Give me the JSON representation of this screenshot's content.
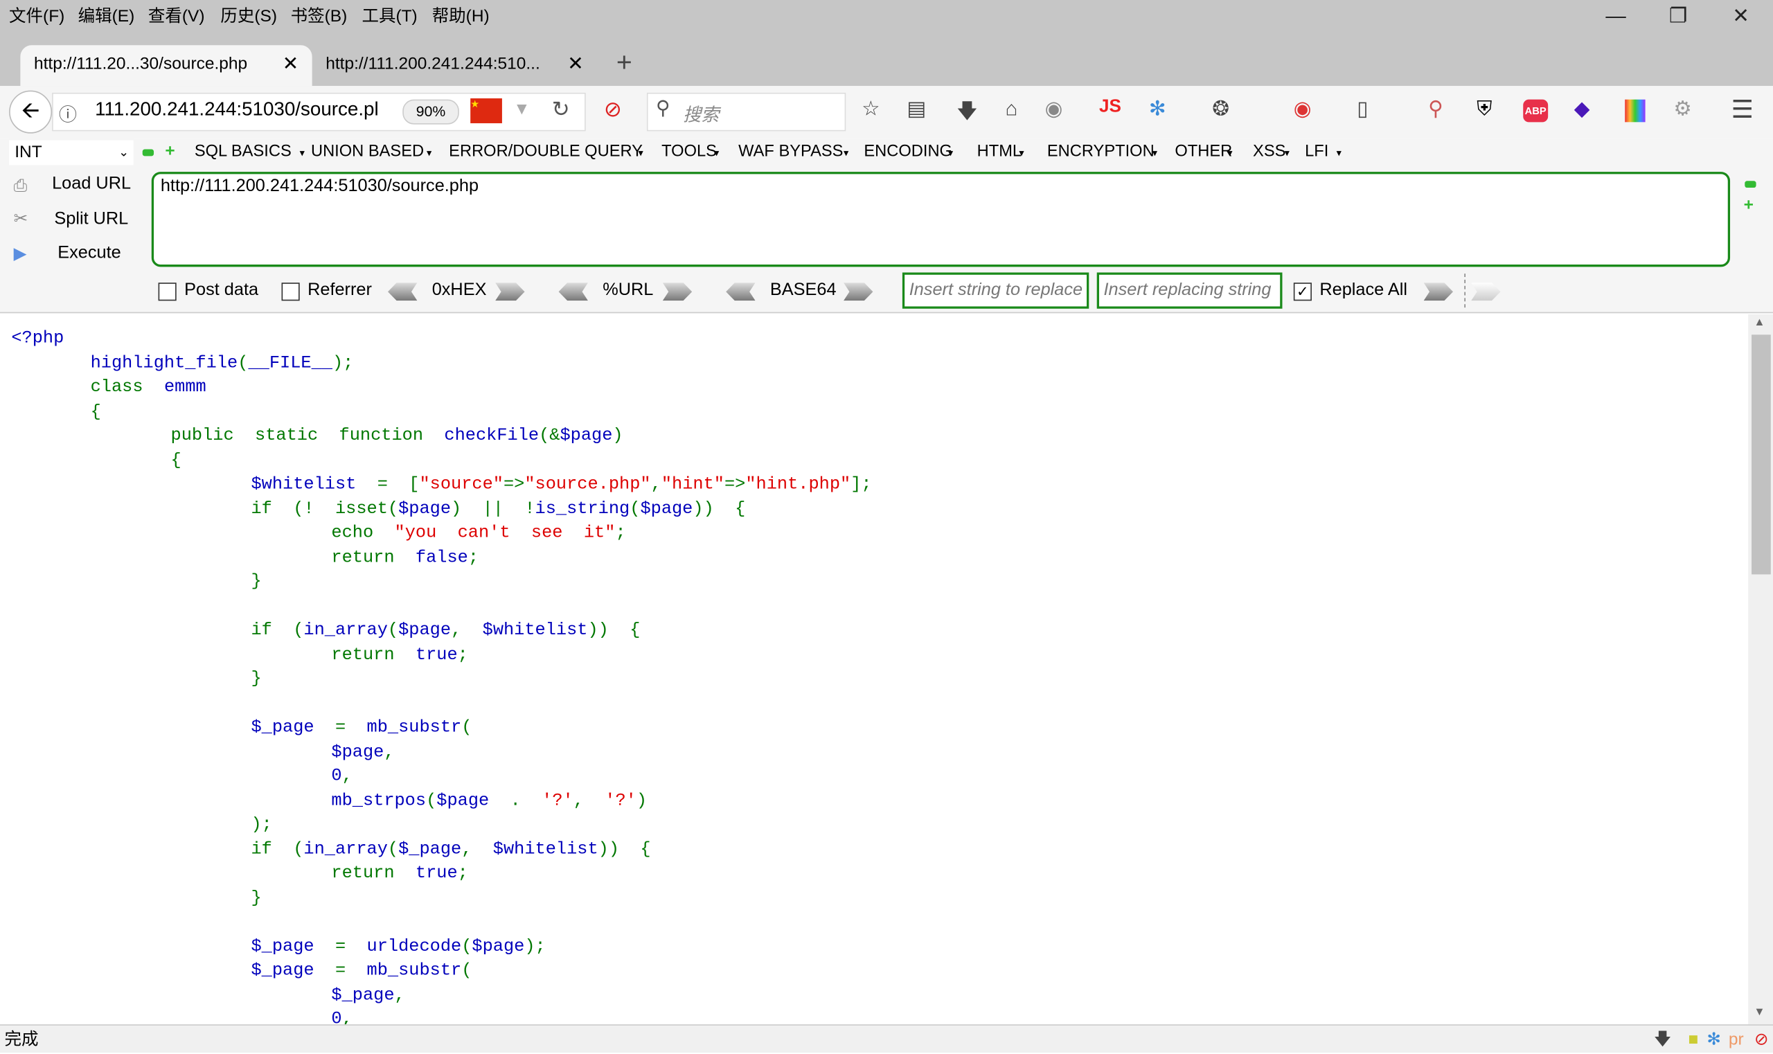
{
  "menu": [
    "文件(F)",
    "编辑(E)",
    "查看(V)",
    "历史(S)",
    "书签(B)",
    "工具(T)",
    "帮助(H)"
  ],
  "tabs": [
    {
      "label": "http://111.20...30/source.php"
    },
    {
      "label": "http://111.200.241.244:510..."
    }
  ],
  "new_tab": "+",
  "address": {
    "url": "111.200.241.244:51030/source.pl",
    "zoom": "90%",
    "search_placeholder": "搜索"
  },
  "toolbar_icons": [
    "star-icon",
    "reading-list-icon",
    "download-icon",
    "home-icon",
    "globe-icon",
    "js-icon",
    "proxy-icon",
    "cookie-icon",
    "web-developer-icon",
    "responsive-icon",
    "search-highlight-icon",
    "shield-w-icon",
    "abp-icon",
    "diamond-icon",
    "rainbow-icon",
    "gear-icon"
  ],
  "js_label": "JS",
  "abp_label": "ABP",
  "hackbar": {
    "select": "INT",
    "menus": [
      "SQL BASICS",
      "UNION BASED",
      "ERROR/DOUBLE QUERY",
      "TOOLS",
      "WAF BYPASS",
      "ENCODING",
      "HTML",
      "ENCRYPTION",
      "OTHER",
      "XSS",
      "LFI"
    ],
    "load": "Load URL",
    "split": "Split URL",
    "execute": "Execute",
    "url": "http://111.200.241.244:51030/source.php",
    "post": "Post data",
    "referrer": "Referrer",
    "hex": "0xHEX",
    "urlenc": "%URL",
    "base64": "BASE64",
    "replace_placeholder": "Insert string to replace",
    "replacing_placeholder": "Insert replacing string",
    "replace_all": "Replace All",
    "replace_all_checked": true,
    "post_checked": false,
    "referrer_checked": false
  },
  "colors": {
    "keyword": "#007700",
    "default": "#0000bb",
    "string": "#dd0000",
    "border": "#1a8a1a"
  },
  "code": [
    {
      "i": 0,
      "t": [
        [
          "<?php",
          "d"
        ]
      ]
    },
    {
      "i": 1,
      "t": [
        [
          "highlight_file",
          "d"
        ],
        [
          "(",
          "k"
        ],
        [
          "__FILE__",
          "d"
        ],
        [
          ");",
          "k"
        ]
      ]
    },
    {
      "i": 1,
      "t": [
        [
          "class  ",
          "k"
        ],
        [
          "emmm",
          "d"
        ]
      ]
    },
    {
      "i": 1,
      "t": [
        [
          "{",
          "k"
        ]
      ]
    },
    {
      "i": 2,
      "t": [
        [
          "public  static  function  ",
          "k"
        ],
        [
          "checkFile",
          "d"
        ],
        [
          "(&",
          "k"
        ],
        [
          "$page",
          "d"
        ],
        [
          ")",
          "k"
        ]
      ]
    },
    {
      "i": 2,
      "t": [
        [
          "{",
          "k"
        ]
      ]
    },
    {
      "i": 3,
      "t": [
        [
          "$whitelist  ",
          "d"
        ],
        [
          "=  [",
          "k"
        ],
        [
          "\"source\"",
          "s"
        ],
        [
          "=>",
          "k"
        ],
        [
          "\"source.php\"",
          "s"
        ],
        [
          ",",
          "k"
        ],
        [
          "\"hint\"",
          "s"
        ],
        [
          "=>",
          "k"
        ],
        [
          "\"hint.php\"",
          "s"
        ],
        [
          "];",
          "k"
        ]
      ]
    },
    {
      "i": 3,
      "t": [
        [
          "if  (!  isset(",
          "k"
        ],
        [
          "$page",
          "d"
        ],
        [
          ")  ||  !",
          "k"
        ],
        [
          "is_string",
          "d"
        ],
        [
          "(",
          "k"
        ],
        [
          "$page",
          "d"
        ],
        [
          "))  {",
          "k"
        ]
      ]
    },
    {
      "i": 4,
      "t": [
        [
          "echo  ",
          "k"
        ],
        [
          "\"you  can't  see  it\"",
          "s"
        ],
        [
          ";",
          "k"
        ]
      ]
    },
    {
      "i": 4,
      "t": [
        [
          "return  ",
          "k"
        ],
        [
          "false",
          "d"
        ],
        [
          ";",
          "k"
        ]
      ]
    },
    {
      "i": 3,
      "t": [
        [
          "}",
          "k"
        ]
      ]
    },
    {
      "i": 3,
      "t": []
    },
    {
      "i": 3,
      "t": [
        [
          "if  (",
          "k"
        ],
        [
          "in_array",
          "d"
        ],
        [
          "(",
          "k"
        ],
        [
          "$page",
          "d"
        ],
        [
          ",  ",
          "k"
        ],
        [
          "$whitelist",
          "d"
        ],
        [
          "))  {",
          "k"
        ]
      ]
    },
    {
      "i": 4,
      "t": [
        [
          "return  ",
          "k"
        ],
        [
          "true",
          "d"
        ],
        [
          ";",
          "k"
        ]
      ]
    },
    {
      "i": 3,
      "t": [
        [
          "}",
          "k"
        ]
      ]
    },
    {
      "i": 3,
      "t": []
    },
    {
      "i": 3,
      "t": [
        [
          "$_page  ",
          "d"
        ],
        [
          "=  ",
          "k"
        ],
        [
          "mb_substr",
          "d"
        ],
        [
          "(",
          "k"
        ]
      ]
    },
    {
      "i": 4,
      "t": [
        [
          "$page",
          "d"
        ],
        [
          ",",
          "k"
        ]
      ]
    },
    {
      "i": 4,
      "t": [
        [
          "0",
          "d"
        ],
        [
          ",",
          "k"
        ]
      ]
    },
    {
      "i": 4,
      "t": [
        [
          "mb_strpos",
          "d"
        ],
        [
          "(",
          "k"
        ],
        [
          "$page  ",
          "d"
        ],
        [
          ".  ",
          "k"
        ],
        [
          "'?'",
          "s"
        ],
        [
          ",  ",
          "k"
        ],
        [
          "'?'",
          "s"
        ],
        [
          ")",
          "k"
        ]
      ]
    },
    {
      "i": 3,
      "t": [
        [
          ");",
          "k"
        ]
      ]
    },
    {
      "i": 3,
      "t": [
        [
          "if  (",
          "k"
        ],
        [
          "in_array",
          "d"
        ],
        [
          "(",
          "k"
        ],
        [
          "$_page",
          "d"
        ],
        [
          ",  ",
          "k"
        ],
        [
          "$whitelist",
          "d"
        ],
        [
          "))  {",
          "k"
        ]
      ]
    },
    {
      "i": 4,
      "t": [
        [
          "return  ",
          "k"
        ],
        [
          "true",
          "d"
        ],
        [
          ";",
          "k"
        ]
      ]
    },
    {
      "i": 3,
      "t": [
        [
          "}",
          "k"
        ]
      ]
    },
    {
      "i": 3,
      "t": []
    },
    {
      "i": 3,
      "t": [
        [
          "$_page  ",
          "d"
        ],
        [
          "=  ",
          "k"
        ],
        [
          "urldecode",
          "d"
        ],
        [
          "(",
          "k"
        ],
        [
          "$page",
          "d"
        ],
        [
          ");",
          "k"
        ]
      ]
    },
    {
      "i": 3,
      "t": [
        [
          "$_page  ",
          "d"
        ],
        [
          "=  ",
          "k"
        ],
        [
          "mb_substr",
          "d"
        ],
        [
          "(",
          "k"
        ]
      ]
    },
    {
      "i": 4,
      "t": [
        [
          "$_page",
          "d"
        ],
        [
          ",",
          "k"
        ]
      ]
    },
    {
      "i": 4,
      "t": [
        [
          "0",
          "d"
        ],
        [
          ",",
          "k"
        ]
      ]
    }
  ],
  "status": "完成"
}
